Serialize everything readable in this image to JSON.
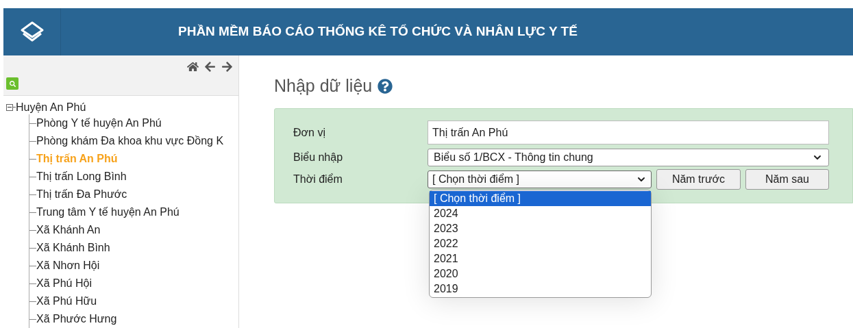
{
  "header": {
    "title": "PHẦN MỀM BÁO CÁO THỐNG KÊ TỔ CHỨC VÀ NHÂN LỰC Y TẾ"
  },
  "tree": {
    "label": "Huyện An Phú",
    "expanded": true,
    "children": [
      {
        "label": "Phòng Y tế huyện An Phú",
        "selected": false
      },
      {
        "label": "Phòng khám Đa khoa khu vực Đồng K",
        "selected": false
      },
      {
        "label": "Thị trấn An Phú",
        "selected": true
      },
      {
        "label": "Thị trấn Long Bình",
        "selected": false
      },
      {
        "label": "Thị trấn Đa Phước",
        "selected": false
      },
      {
        "label": "Trung tâm Y tế huyện An Phú",
        "selected": false
      },
      {
        "label": "Xã Khánh An",
        "selected": false
      },
      {
        "label": "Xã Khánh Bình",
        "selected": false
      },
      {
        "label": "Xã Nhơn Hội",
        "selected": false
      },
      {
        "label": "Xã Phú Hội",
        "selected": false
      },
      {
        "label": "Xã Phú Hữu",
        "selected": false
      },
      {
        "label": "Xã Phước Hưng",
        "selected": false
      }
    ]
  },
  "page_title": "Nhập dữ liệu",
  "form": {
    "unit": {
      "label": "Đơn vị",
      "value": "Thị trấn An Phú"
    },
    "template": {
      "label": "Biểu nhập",
      "value": "Biểu số 1/BCX - Thông tin chung"
    },
    "period": {
      "label": "Thời điểm",
      "value": "[ Chọn thời điểm ]",
      "expanded": true,
      "options": [
        {
          "label": "[ Chọn thời điểm ]",
          "selected": true
        },
        {
          "label": "2024",
          "selected": false
        },
        {
          "label": "2023",
          "selected": false
        },
        {
          "label": "2022",
          "selected": false
        },
        {
          "label": "2021",
          "selected": false
        },
        {
          "label": "2020",
          "selected": false
        },
        {
          "label": "2019",
          "selected": false
        }
      ]
    },
    "buttons": [
      "Năm trước",
      "Năm sau"
    ]
  }
}
